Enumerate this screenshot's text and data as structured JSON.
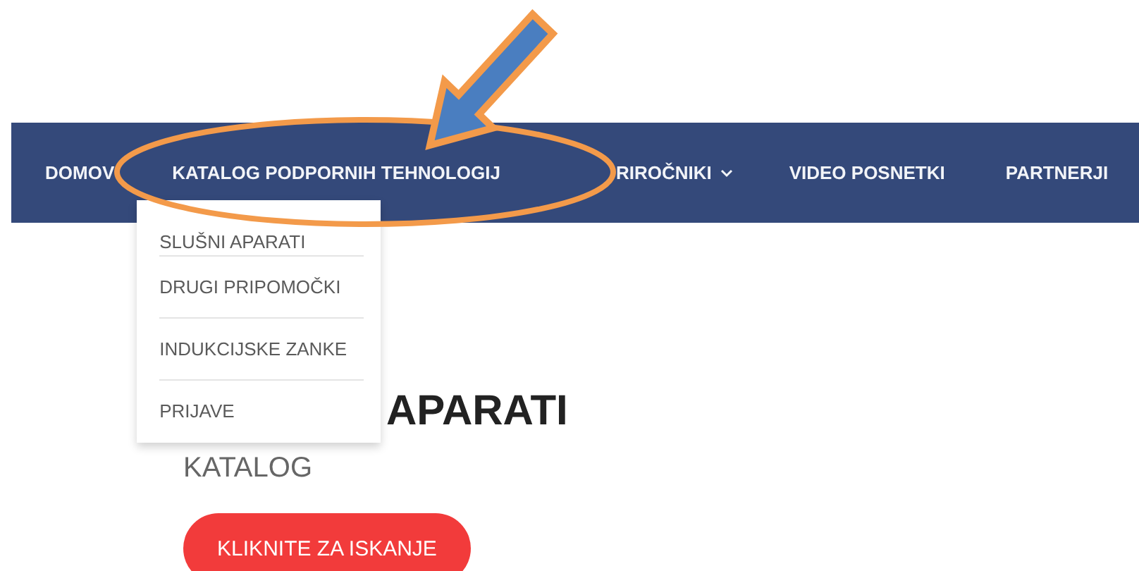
{
  "nav": {
    "items": [
      {
        "label": "DOMOV",
        "kind": "link"
      },
      {
        "label": "KATALOG PODPORNIH TEHNOLOGIJ",
        "kind": "link",
        "expanded": true,
        "submenu": [
          "SLUŠNI APARATI",
          "DRUGI PRIPOMOČKI",
          "INDUKCIJSKE ZANKE",
          "PRIJAVE"
        ]
      },
      {
        "label": "RIROČNIKI",
        "kind": "menu"
      },
      {
        "label": "VIDEO POSNETKI",
        "kind": "link"
      },
      {
        "label": "PARTNERJI",
        "kind": "link"
      }
    ]
  },
  "content": {
    "heading": "APARATI",
    "subtitle": "KATALOG",
    "button": "KLIKNITE ZA ISKANJE"
  },
  "annotations": [
    {
      "kind": "ellipse"
    },
    {
      "kind": "arrow"
    }
  ]
}
